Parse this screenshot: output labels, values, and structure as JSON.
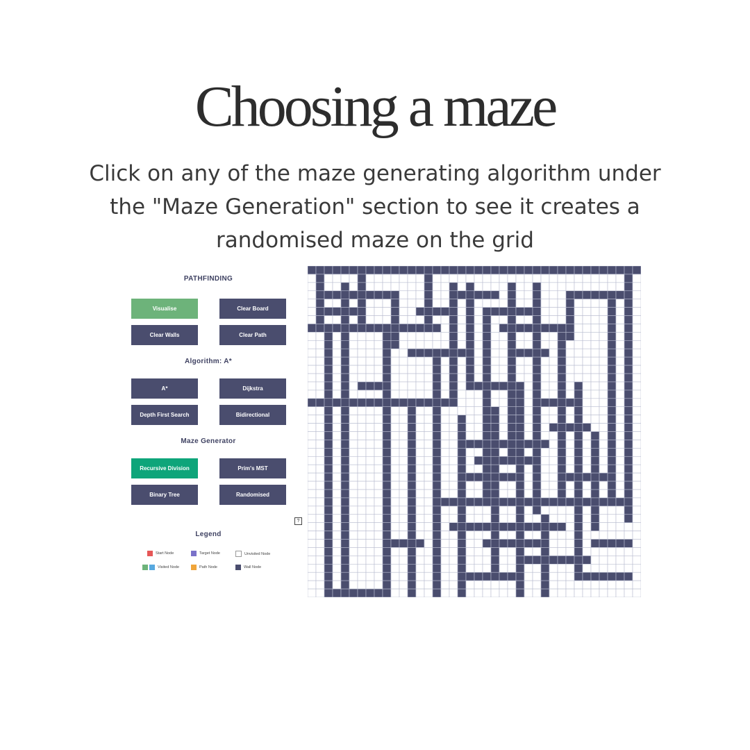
{
  "heading": "Choosing a maze",
  "subtitle": "Click on any of the maze generating algorithm under the \"Maze Generation\" section to see it creates a randomised maze on the grid",
  "panel": {
    "pathfinding_title": "PATHFINDING",
    "visualise": "Visualise",
    "clear_board": "Clear Board",
    "clear_walls": "Clear Walls",
    "clear_path": "Clear Path",
    "algorithm_title": "Algorithm: A*",
    "astar": "A*",
    "dijkstra": "Dijkstra",
    "dfs": "Depth First Search",
    "bidirectional": "Bidirectional",
    "maze_title": "Maze Generator",
    "recursive_division": "Recursive Division",
    "prims": "Prim's MST",
    "binary_tree": "Binary Tree",
    "randomised": "Randomised",
    "help": "?",
    "legend_title": "Legend",
    "legend": {
      "start": "Start Node",
      "target": "Target Node",
      "unvisited": "Unvisited Node",
      "visited": "Visited Node",
      "path": "Path Node",
      "wall": "Wall Node"
    }
  },
  "colors": {
    "button": "#4a4d6e",
    "visualise": "#6db37a",
    "active_maze": "#0ea57a",
    "wall": "#4a4d6e",
    "start": "#e65757",
    "target": "#7a72c9",
    "visited_a": "#6db37a",
    "visited_b": "#58a9e0",
    "path": "#f0a53a"
  },
  "grid": {
    "rows": 40,
    "cols": 40,
    "wall_segments_h": [
      [
        0,
        0,
        39
      ],
      [
        3,
        2,
        10
      ],
      [
        3,
        18,
        22
      ],
      [
        3,
        31,
        38
      ],
      [
        5,
        2,
        6
      ],
      [
        5,
        13,
        16
      ],
      [
        5,
        21,
        26
      ],
      [
        7,
        0,
        15
      ],
      [
        7,
        23,
        30
      ],
      [
        10,
        12,
        18
      ],
      [
        10,
        24,
        28
      ],
      [
        14,
        6,
        9
      ],
      [
        14,
        20,
        25
      ],
      [
        16,
        0,
        17
      ],
      [
        16,
        27,
        32
      ],
      [
        19,
        29,
        33
      ],
      [
        21,
        18,
        28
      ],
      [
        23,
        20,
        26
      ],
      [
        25,
        19,
        24
      ],
      [
        25,
        30,
        35
      ],
      [
        28,
        16,
        38
      ],
      [
        31,
        17,
        30
      ],
      [
        33,
        10,
        13
      ],
      [
        33,
        21,
        27
      ],
      [
        33,
        34,
        38
      ],
      [
        35,
        26,
        33
      ],
      [
        37,
        18,
        24
      ],
      [
        37,
        32,
        38
      ],
      [
        39,
        3,
        9
      ]
    ],
    "wall_segments_v": [
      [
        1,
        1,
        7
      ],
      [
        2,
        8,
        39
      ],
      [
        4,
        2,
        39
      ],
      [
        6,
        1,
        7
      ],
      [
        9,
        8,
        39
      ],
      [
        10,
        3,
        9
      ],
      [
        12,
        17,
        39
      ],
      [
        14,
        1,
        7
      ],
      [
        15,
        10,
        39
      ],
      [
        17,
        2,
        16
      ],
      [
        18,
        18,
        39
      ],
      [
        19,
        2,
        14
      ],
      [
        21,
        5,
        27
      ],
      [
        22,
        17,
        36
      ],
      [
        24,
        2,
        23
      ],
      [
        25,
        14,
        39
      ],
      [
        27,
        2,
        29
      ],
      [
        28,
        30,
        39
      ],
      [
        30,
        8,
        27
      ],
      [
        31,
        3,
        8
      ],
      [
        32,
        14,
        37
      ],
      [
        34,
        20,
        31
      ],
      [
        36,
        3,
        27
      ],
      [
        38,
        1,
        30
      ]
    ]
  }
}
